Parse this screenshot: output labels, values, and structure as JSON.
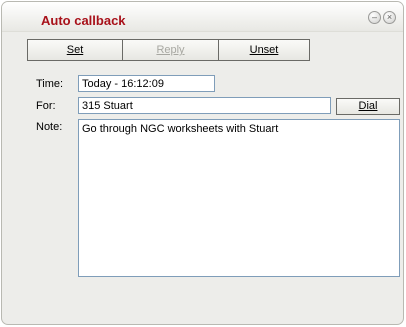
{
  "window": {
    "title": "Auto callback",
    "minimize_glyph": "–",
    "close_glyph": "×"
  },
  "toolbar": {
    "set_label": "Set",
    "reply_label": "Reply",
    "unset_label": "Unset"
  },
  "form": {
    "time_label": "Time:",
    "time_value": "Today - 16:12:09",
    "for_label": "For:",
    "for_value": "315 Stuart",
    "dial_label": "Dial",
    "note_label": "Note:",
    "note_value": "Go through NGC worksheets with Stuart"
  },
  "colors": {
    "title": "#a8111a",
    "window_bg": "#ededea",
    "field_border": "#7f9db9"
  }
}
